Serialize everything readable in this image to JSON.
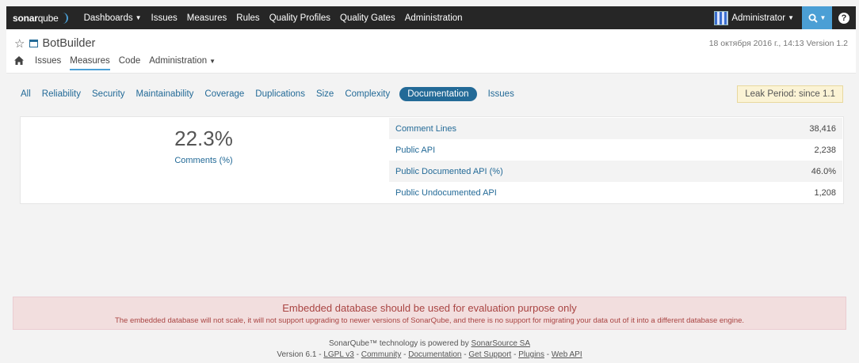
{
  "navbar": {
    "logo_bold": "sonar",
    "logo_light": "qube",
    "items": [
      {
        "label": "Dashboards",
        "dropdown": true
      },
      {
        "label": "Issues"
      },
      {
        "label": "Measures"
      },
      {
        "label": "Rules"
      },
      {
        "label": "Quality Profiles"
      },
      {
        "label": "Quality Gates"
      },
      {
        "label": "Administration"
      }
    ],
    "user": "Administrator",
    "search_icon": "search-icon",
    "help_label": "?"
  },
  "project": {
    "name": "BotBuilder",
    "meta": "18 октября 2016 г., 14:13   Version 1.2",
    "nav": [
      "Issues",
      "Measures",
      "Code",
      "Administration"
    ]
  },
  "domains": {
    "tabs": [
      "All",
      "Reliability",
      "Security",
      "Maintainability",
      "Coverage",
      "Duplications",
      "Size",
      "Complexity",
      "Documentation",
      "Issues"
    ],
    "active": "Documentation",
    "leak_period": "Leak Period: since 1.1"
  },
  "measures": {
    "main_value": "22.3%",
    "main_label": "Comments (%)",
    "rows": [
      {
        "label": "Comment Lines",
        "value": "38,416"
      },
      {
        "label": "Public API",
        "value": "2,238"
      },
      {
        "label": "Public Documented API (%)",
        "value": "46.0%"
      },
      {
        "label": "Public Undocumented API",
        "value": "1,208"
      }
    ]
  },
  "banner": {
    "title": "Embedded database should be used for evaluation purpose only",
    "text": "The embedded database will not scale, it will not support upgrading to newer versions of SonarQube, and there is no support for migrating your data out of it into a different database engine."
  },
  "footer": {
    "powered_prefix": "SonarQube™ technology is powered by ",
    "powered_link": "SonarSource SA",
    "version": "Version 6.1",
    "links": [
      "LGPL v3",
      "Community",
      "Documentation",
      "Get Support",
      "Plugins",
      "Web API"
    ],
    "separator": " - "
  }
}
